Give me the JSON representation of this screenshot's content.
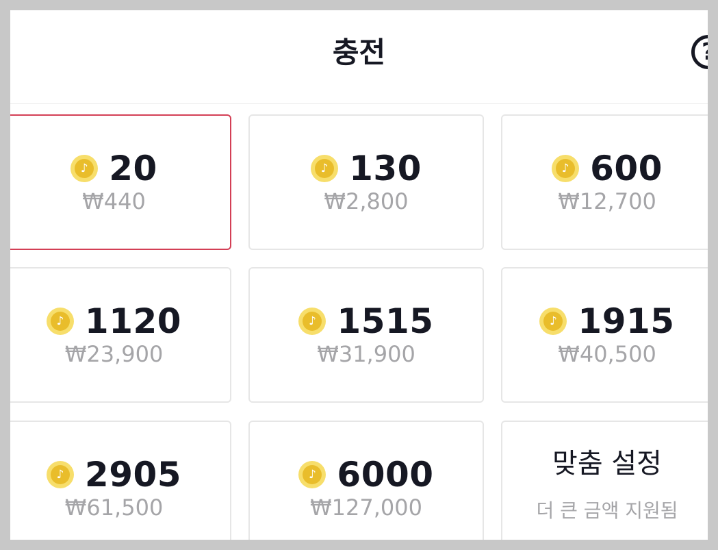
{
  "header": {
    "title": "충전",
    "help_icon": "question-circle-icon",
    "help_glyph": "?"
  },
  "coin_icon": {
    "name": "tiktok-coin-icon",
    "glyph": "♪"
  },
  "packages": [
    {
      "coins": "20",
      "price": "₩440",
      "selected": true
    },
    {
      "coins": "130",
      "price": "₩2,800",
      "selected": false
    },
    {
      "coins": "600",
      "price": "₩12,700",
      "selected": false
    },
    {
      "coins": "1120",
      "price": "₩23,900",
      "selected": false
    },
    {
      "coins": "1515",
      "price": "₩31,900",
      "selected": false
    },
    {
      "coins": "1915",
      "price": "₩40,500",
      "selected": false
    },
    {
      "coins": "2905",
      "price": "₩61,500",
      "selected": false
    },
    {
      "coins": "6000",
      "price": "₩127,000",
      "selected": false
    }
  ],
  "custom": {
    "title": "맞춤 설정",
    "subtitle": "더 큰 금액 지원됨"
  },
  "colors": {
    "selected_border": "#d33f55",
    "coin": "#e9bd2b",
    "price_text": "#a5a5a8"
  }
}
